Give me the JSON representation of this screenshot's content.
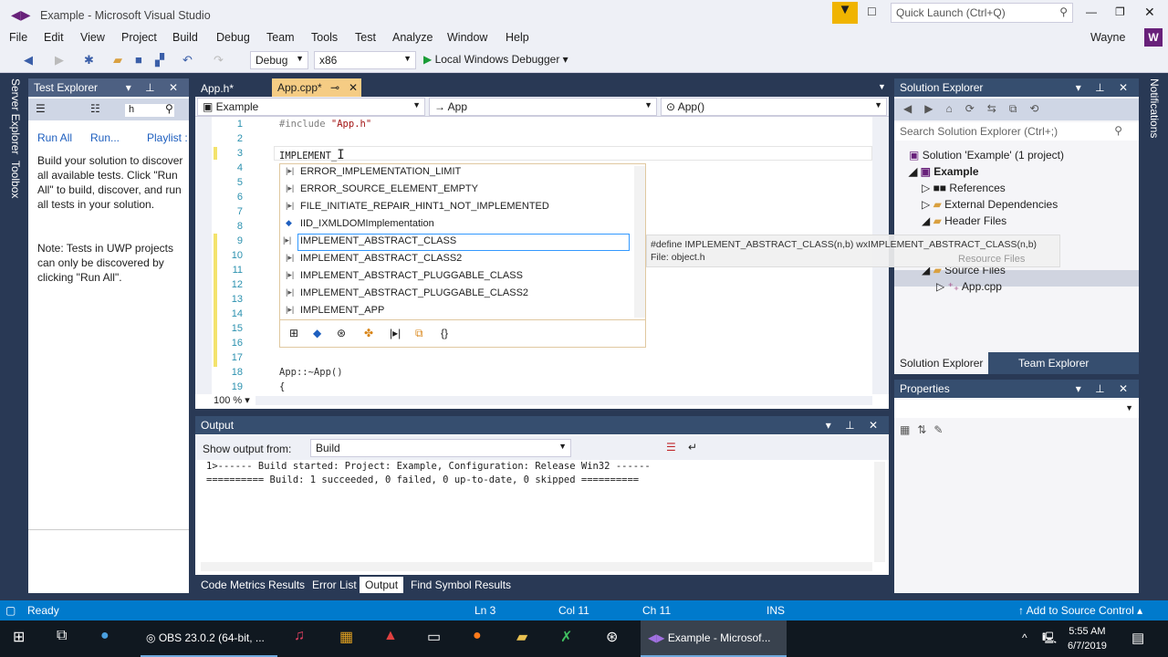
{
  "window": {
    "title": "Example - Microsoft Visual Studio",
    "quick_launch": "Quick Launch (Ctrl+Q)",
    "user": "Wayne",
    "user_initial": "W"
  },
  "menu": [
    "File",
    "Edit",
    "View",
    "Project",
    "Build",
    "Debug",
    "Team",
    "Tools",
    "Test",
    "Analyze",
    "Window",
    "Help"
  ],
  "toolbar": {
    "config": "Debug",
    "platform": "x86",
    "run": "Local Windows Debugger"
  },
  "side_tabs": {
    "left": [
      "Server Explorer",
      "Toolbox"
    ],
    "right": "Notifications"
  },
  "test_explorer": {
    "title": "Test Explorer",
    "search": "h",
    "run_all": "Run All",
    "run": "Run...",
    "playlist": "Playlist :",
    "message": "Build your solution to discover all available tests. Click \"Run All\" to build, discover, and run all tests in your solution.",
    "note": "Note: Tests in UWP projects can only be discovered by clicking \"Run All\"."
  },
  "editor": {
    "tabs": [
      {
        "label": "App.h*"
      },
      {
        "label": "App.cpp*"
      }
    ],
    "nav": {
      "project": "Example",
      "scope": "App",
      "member": "App()"
    },
    "zoom": "100 %",
    "lines": [
      "1",
      "2",
      "3",
      "4",
      "5",
      "6",
      "7",
      "8",
      "9",
      "10",
      "11",
      "12",
      "13",
      "14",
      "15",
      "16",
      "17",
      "18",
      "19"
    ],
    "code": {
      "include_kw": "#include",
      "include_file": "\"App.h\"",
      "line3": "IMPLEMENT_",
      "line18": "App::~App()",
      "line19": "{"
    }
  },
  "autocomplete": {
    "items": [
      "ERROR_IMPLEMENTATION_LIMIT",
      "ERROR_SOURCE_ELEMENT_EMPTY",
      "FILE_INITIATE_REPAIR_HINT1_NOT_IMPLEMENTED",
      "IID_IXMLDOMImplementation",
      "IMPLEMENT_ABSTRACT_CLASS",
      "IMPLEMENT_ABSTRACT_CLASS2",
      "IMPLEMENT_ABSTRACT_PLUGGABLE_CLASS",
      "IMPLEMENT_ABSTRACT_PLUGGABLE_CLASS2",
      "IMPLEMENT_APP"
    ],
    "selected": 4,
    "tooltip": {
      "define": "#define IMPLEMENT_ABSTRACT_CLASS(n,b) wxIMPLEMENT_ABSTRACT_CLASS(n,b)",
      "file": "File: object.h"
    }
  },
  "solution_explorer": {
    "title": "Solution Explorer",
    "search": "Search Solution Explorer (Ctrl+;)",
    "solution": "Solution 'Example' (1 project)",
    "project": "Example",
    "nodes": [
      "References",
      "External Dependencies",
      "Header Files",
      "Resource Files",
      "Source Files",
      "App.cpp"
    ],
    "tabs": [
      "Solution Explorer",
      "Team Explorer"
    ]
  },
  "properties": {
    "title": "Properties"
  },
  "output": {
    "title": "Output",
    "show_from_label": "Show output from:",
    "source": "Build",
    "lines": [
      "1>------ Build started: Project: Example, Configuration: Release Win32 ------",
      "========== Build: 1 succeeded, 0 failed, 0 up-to-date, 0 skipped =========="
    ]
  },
  "bottom_tabs": [
    "Code Metrics Results",
    "Error List",
    "Output",
    "Find Symbol Results"
  ],
  "status": {
    "ready": "Ready",
    "ln": "Ln 3",
    "col": "Col 11",
    "ch": "Ch 11",
    "ins": "INS",
    "source_control": "Add to Source Control"
  },
  "taskbar": {
    "obs": "OBS 23.0.2 (64-bit, ...",
    "vs": "Example - Microsof...",
    "time": "5:55 AM",
    "date": "6/7/2019"
  }
}
